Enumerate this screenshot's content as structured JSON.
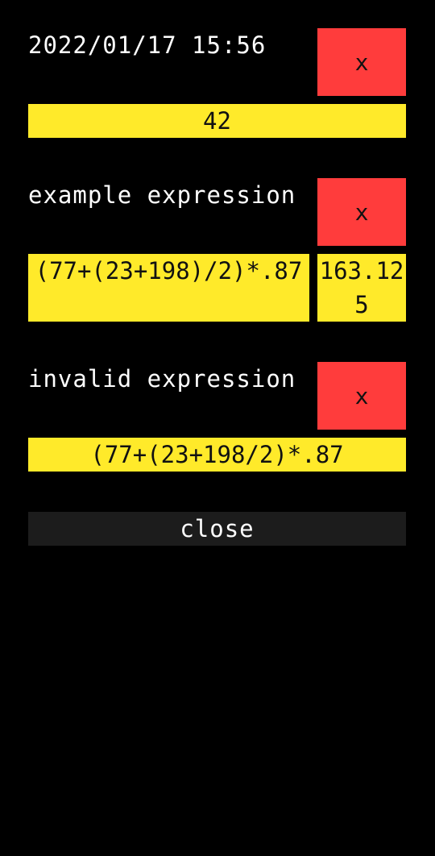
{
  "entries": [
    {
      "title": "2022/01/17 15:56",
      "delete_label": "x",
      "result": "42"
    },
    {
      "title": "example expression",
      "delete_label": "x",
      "expression": "(77+(23+198)/2)*.87",
      "result": "163.125"
    },
    {
      "title": "invalid expression",
      "delete_label": "x",
      "expression": "(77+(23+198/2)*.87"
    }
  ],
  "close_label": "close",
  "colors": {
    "background": "#000000",
    "delete": "#ff3c3c",
    "result": "#ffea2a",
    "close": "#1c1c1c"
  }
}
